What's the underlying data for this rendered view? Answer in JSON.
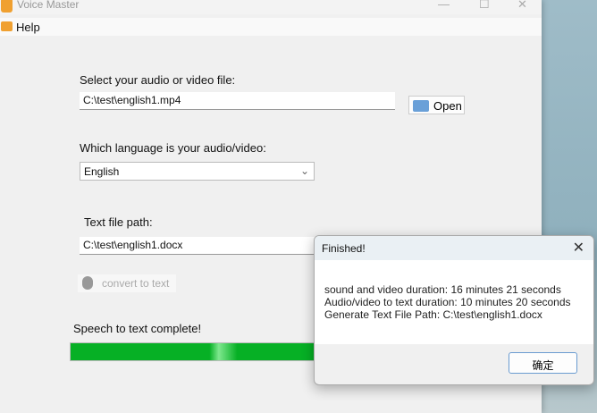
{
  "window": {
    "title": "Voice Master",
    "minimize": "—",
    "maximize": "☐",
    "close": "✕"
  },
  "menu": {
    "help": "Help"
  },
  "form": {
    "file_label": "Select your audio or video file:",
    "file_value": "C:\\test\\english1.mp4",
    "open_label": "Open",
    "language_label": "Which language is your audio/video:",
    "language_value": "English",
    "text_path_label": "Text file path:",
    "text_path_value": "C:\\test\\english1.docx",
    "convert_label": "convert to text",
    "status": "Speech to text complete!",
    "progress_percent": 100,
    "progress_color": "#06b025"
  },
  "dialog": {
    "title": "Finished!",
    "close": "✕",
    "lines": [
      "sound and video duration:  16 minutes 21 seconds",
      "Audio/video to text duration: 10 minutes 20 seconds",
      "Generate Text File Path: C:\\test\\english1.docx"
    ],
    "ok_label": "确定"
  }
}
